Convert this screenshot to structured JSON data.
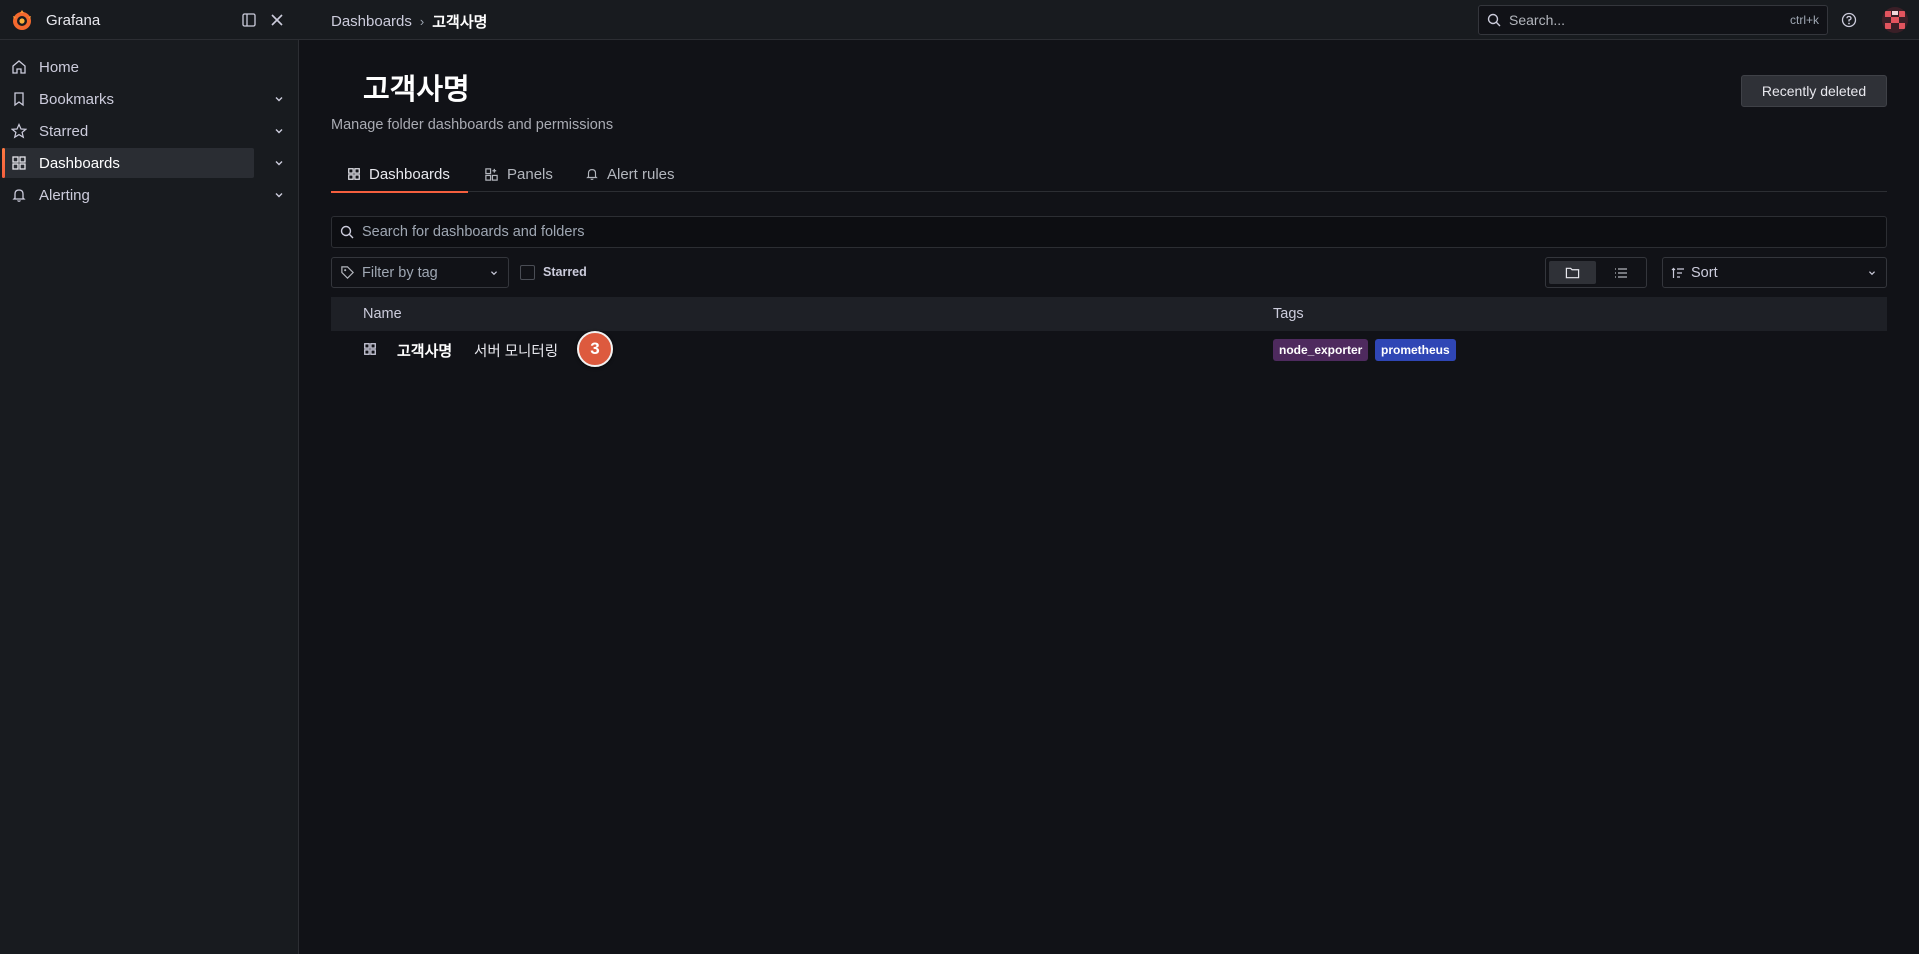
{
  "app": {
    "name": "Grafana"
  },
  "breadcrumb": {
    "parent": "Dashboards",
    "separator": "›",
    "current": "고객사명"
  },
  "top_search": {
    "placeholder": "Search...",
    "shortcut": "ctrl+k"
  },
  "sidebar": {
    "items": [
      {
        "label": "Home",
        "icon": "home-icon"
      },
      {
        "label": "Bookmarks",
        "icon": "bookmark-icon"
      },
      {
        "label": "Starred",
        "icon": "star-icon"
      },
      {
        "label": "Dashboards",
        "icon": "apps-icon",
        "active": true
      },
      {
        "label": "Alerting",
        "icon": "bell-icon"
      }
    ]
  },
  "page": {
    "title": "고객사명",
    "subtitle": "Manage folder dashboards and permissions",
    "recently_deleted": "Recently deleted"
  },
  "tabs": [
    {
      "label": "Dashboards",
      "icon": "apps-icon",
      "active": true
    },
    {
      "label": "Panels",
      "icon": "library-panel-icon"
    },
    {
      "label": "Alert rules",
      "icon": "bell-icon"
    }
  ],
  "search": {
    "placeholder": "Search for dashboards and folders"
  },
  "filters": {
    "tag_placeholder": "Filter by tag",
    "starred_label": "Starred",
    "sort_label": "Sort"
  },
  "table": {
    "columns": [
      "Name",
      "Tags"
    ],
    "rows": [
      {
        "name_part1": "고객사명",
        "name_part2": "서버 모니터링",
        "marker": "3",
        "tags": [
          {
            "label": "node_exporter",
            "color": "#4e2a5e"
          },
          {
            "label": "prometheus",
            "color": "#2f46b5"
          }
        ]
      }
    ]
  },
  "colors": {
    "accent": "#f55f3e",
    "background": "#111217",
    "panel": "#181b1f"
  }
}
